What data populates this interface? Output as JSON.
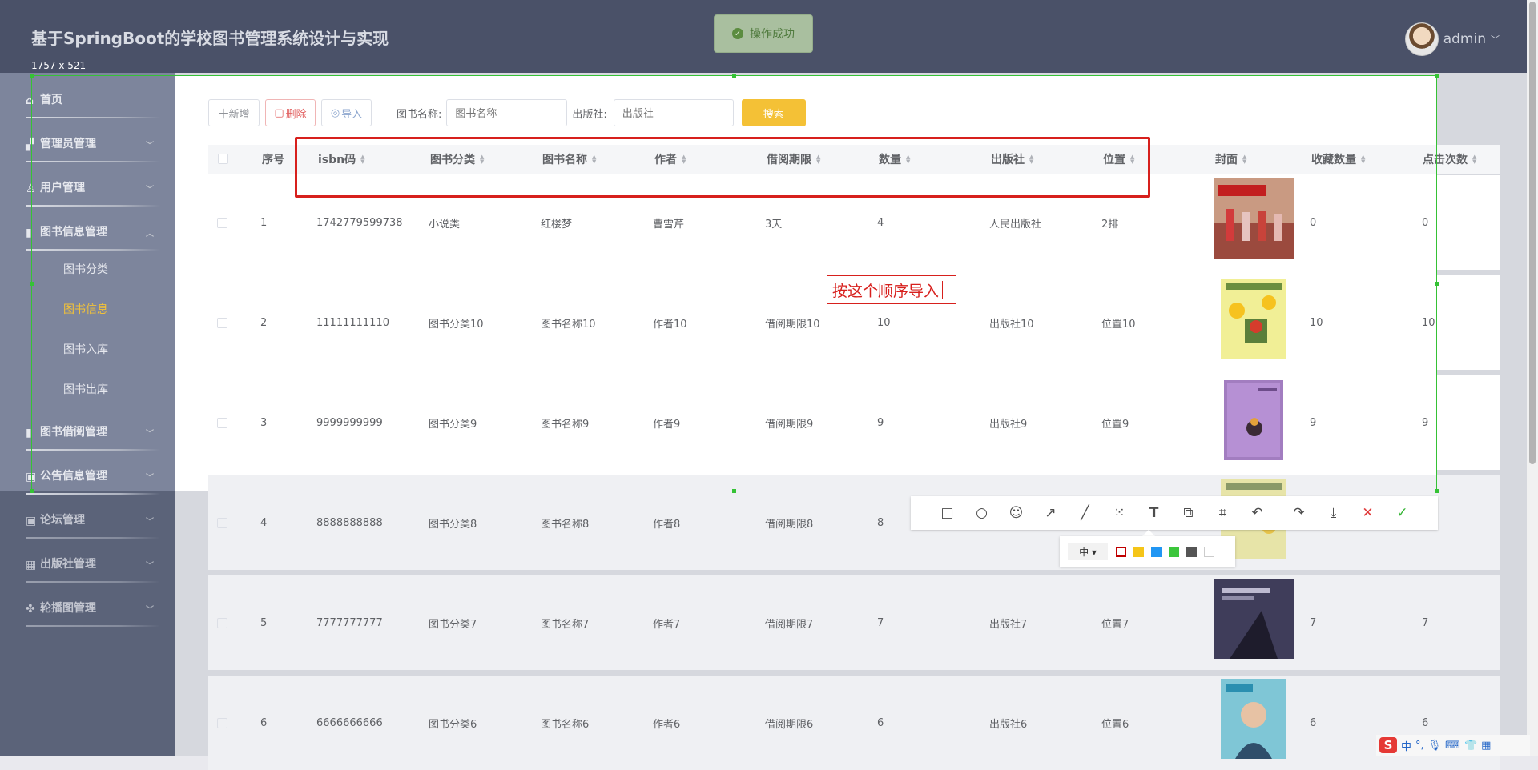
{
  "header": {
    "title": "基于SpringBoot的学校图书管理系统设计与实现",
    "toast": "操作成功",
    "user": "admin",
    "selection_dims": "1757 x 521"
  },
  "sidebar": {
    "items": [
      {
        "label": "首页"
      },
      {
        "label": "管理员管理"
      },
      {
        "label": "用户管理"
      },
      {
        "label": "图书信息管理"
      },
      {
        "label": "图书借阅管理"
      },
      {
        "label": "公告信息管理"
      },
      {
        "label": "论坛管理"
      },
      {
        "label": "出版社管理"
      },
      {
        "label": "轮播图管理"
      }
    ],
    "sub_items": [
      {
        "label": "图书分类"
      },
      {
        "label": "图书信息"
      },
      {
        "label": "图书入库"
      },
      {
        "label": "图书出库"
      }
    ]
  },
  "toolbar": {
    "add_label": "十新增",
    "delete_label": "删除",
    "import_label": "导入",
    "name_label": "图书名称:",
    "name_placeholder": "图书名称",
    "publisher_label": "出版社:",
    "publisher_placeholder": "出版社",
    "search_label": "搜索"
  },
  "table": {
    "columns": [
      "序号",
      "isbn码",
      "图书分类",
      "图书名称",
      "作者",
      "借阅期限",
      "数量",
      "出版社",
      "位置",
      "封面",
      "收藏数量",
      "点击次数"
    ],
    "rows": [
      {
        "no": "1",
        "isbn": "1742779599738",
        "category": "小说类",
        "name": "红楼梦",
        "author": "曹雪芹",
        "period": "3天",
        "qty": "4",
        "publisher": "人民出版社",
        "location": "2排",
        "fav": "0",
        "clicks": "0"
      },
      {
        "no": "2",
        "isbn": "11111111110",
        "category": "图书分类10",
        "name": "图书名称10",
        "author": "作者10",
        "period": "借阅期限10",
        "qty": "10",
        "publisher": "出版社10",
        "location": "位置10",
        "fav": "10",
        "clicks": "10"
      },
      {
        "no": "3",
        "isbn": "9999999999",
        "category": "图书分类9",
        "name": "图书名称9",
        "author": "作者9",
        "period": "借阅期限9",
        "qty": "9",
        "publisher": "出版社9",
        "location": "位置9",
        "fav": "9",
        "clicks": "9"
      },
      {
        "no": "4",
        "isbn": "8888888888",
        "category": "图书分类8",
        "name": "图书名称8",
        "author": "作者8",
        "period": "借阅期限8",
        "qty": "8",
        "publisher": "",
        "location": "",
        "fav": "",
        "clicks": ""
      },
      {
        "no": "5",
        "isbn": "7777777777",
        "category": "图书分类7",
        "name": "图书名称7",
        "author": "作者7",
        "period": "借阅期限7",
        "qty": "7",
        "publisher": "出版社7",
        "location": "位置7",
        "fav": "7",
        "clicks": "7"
      },
      {
        "no": "6",
        "isbn": "6666666666",
        "category": "图书分类6",
        "name": "图书名称6",
        "author": "作者6",
        "period": "借阅期限6",
        "qty": "6",
        "publisher": "出版社6",
        "location": "位置6",
        "fav": "6",
        "clicks": "6"
      }
    ]
  },
  "annotation": {
    "text": "按这个顺序导入"
  },
  "screenshot_tool": {
    "size_label": "中 ▾",
    "colors": [
      "#c00000",
      "#f5c518",
      "#2196f3",
      "#3cc63c",
      "#555555",
      "#ffffff"
    ]
  },
  "ime": {
    "label": "中"
  }
}
